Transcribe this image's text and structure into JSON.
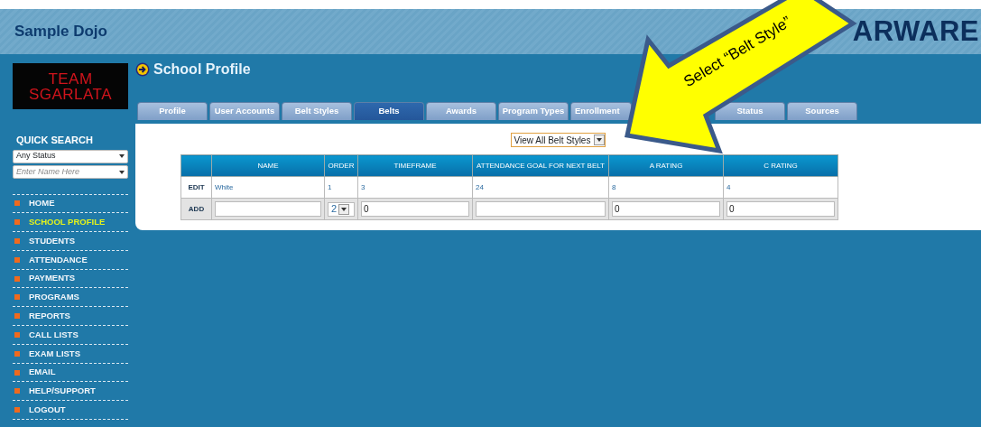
{
  "header": {
    "title": "Sample Dojo",
    "brand": "ARWARE"
  },
  "logo": {
    "line_1": "TEAM",
    "line_2": "SGARLATA"
  },
  "quick_search": {
    "title": "QUICK SEARCH",
    "status_select": {
      "value": "Any Status"
    },
    "name_field": {
      "placeholder": "Enter Name Here"
    }
  },
  "sidebar": {
    "items": [
      {
        "label": "HOME",
        "selected": false
      },
      {
        "label": "SCHOOL PROFILE",
        "selected": true
      },
      {
        "label": "STUDENTS",
        "selected": false
      },
      {
        "label": "ATTENDANCE",
        "selected": false
      },
      {
        "label": "PAYMENTS",
        "selected": false
      },
      {
        "label": "PROGRAMS",
        "selected": false
      },
      {
        "label": "REPORTS",
        "selected": false
      },
      {
        "label": "CALL LISTS",
        "selected": false
      },
      {
        "label": "EXAM LISTS",
        "selected": false
      },
      {
        "label": "EMAIL",
        "selected": false
      },
      {
        "label": "HELP/SUPPORT",
        "selected": false
      },
      {
        "label": "LOGOUT",
        "selected": false
      }
    ]
  },
  "page_title": "School Profile",
  "tabs": [
    {
      "label": "Profile",
      "selected": false
    },
    {
      "label": "User Accounts",
      "selected": false
    },
    {
      "label": "Belt Styles",
      "selected": false
    },
    {
      "label": "Belts",
      "selected": true
    },
    {
      "label": "Awards",
      "selected": false
    },
    {
      "label": "Program Types",
      "selected": false
    },
    {
      "label": "Enrollment",
      "selected": false
    },
    {
      "label": "Status",
      "selected": false
    },
    {
      "label": "Sources",
      "selected": false
    }
  ],
  "filter_select": {
    "value": "View All Belt Styles"
  },
  "table": {
    "columns": [
      "NAME",
      "ORDER",
      "TIMEFRAME",
      "ATTENDANCE GOAL FOR NEXT BELT",
      "A RATING",
      "C RATING"
    ],
    "rows": [
      {
        "action": "EDIT",
        "cells": [
          "White",
          "1",
          "3",
          "24",
          "8",
          "4"
        ]
      }
    ],
    "add_row": {
      "action": "ADD",
      "fields": [
        {
          "kind": "text"
        },
        {
          "kind": "select",
          "value": "2"
        },
        {
          "kind": "text",
          "value": "0"
        },
        {
          "kind": "text"
        },
        {
          "kind": "text",
          "value": "0"
        },
        {
          "kind": "text",
          "value": "0"
        }
      ]
    }
  },
  "callout": {
    "text": "Select “Belt Style”"
  }
}
